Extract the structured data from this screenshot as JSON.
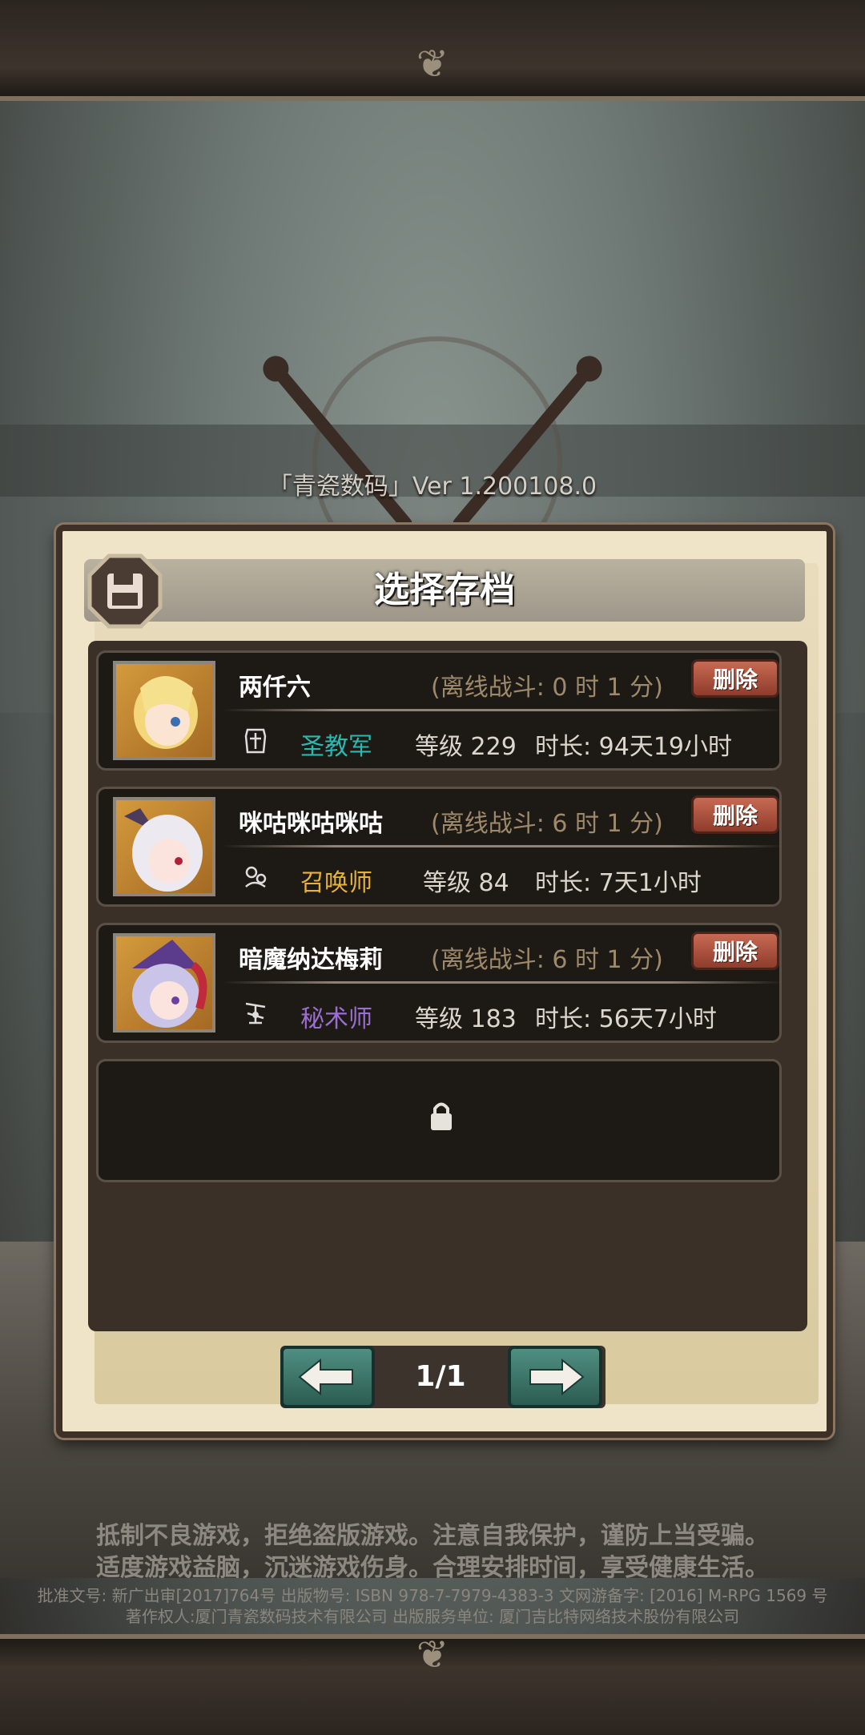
{
  "version": "「青瓷数码」Ver 1.200108.0",
  "dialog": {
    "title": "选择存档",
    "save_icon": "floppy-disk-icon",
    "delete_label": "删除"
  },
  "slots": [
    {
      "name": "两仟六",
      "offline": "(离线战斗:  0 时 1 分)",
      "class_icon": "crusader-shield-icon",
      "class_name": "圣教军",
      "class_color": "#2bb8b0",
      "level": "等级 229",
      "duration": "时长: 94天19小时",
      "delete": "删除"
    },
    {
      "name": "咪咕咪咕咪咕",
      "offline": "(离线战斗:  6 时 1 分)",
      "class_icon": "summoner-icon",
      "class_name": "召唤师",
      "class_color": "#e8b23a",
      "level": "等级 84",
      "duration": "时长: 7天1小时",
      "delete": "删除"
    },
    {
      "name": "暗魔纳达梅莉",
      "offline": "(离线战斗:  6 时 1 分)",
      "class_icon": "arcanist-icon",
      "class_name": "秘术师",
      "class_color": "#9a6fcf",
      "level": "等级 183",
      "duration": "时长: 56天7小时",
      "delete": "删除"
    }
  ],
  "empty_slot": {
    "icon": "lock-icon"
  },
  "pager": {
    "page": "1/1",
    "prev_icon": "arrow-left-icon",
    "next_icon": "arrow-right-icon"
  },
  "notice": {
    "line1": "抵制不良游戏，拒绝盗版游戏。注意自我保护，谨防上当受骗。",
    "line2": "适度游戏益脑，沉迷游戏伤身。合理安排时间，享受健康生活。",
    "legal1": "批准文号: 新广出审[2017]764号 出版物号: ISBN 978-7-7979-4383-3 文网游备字: [2016] M-RPG 1569 号",
    "legal2": "著作权人:厦门青瓷数码技术有限公司 出版服务单位: 厦门吉比特网络技术股份有限公司"
  }
}
